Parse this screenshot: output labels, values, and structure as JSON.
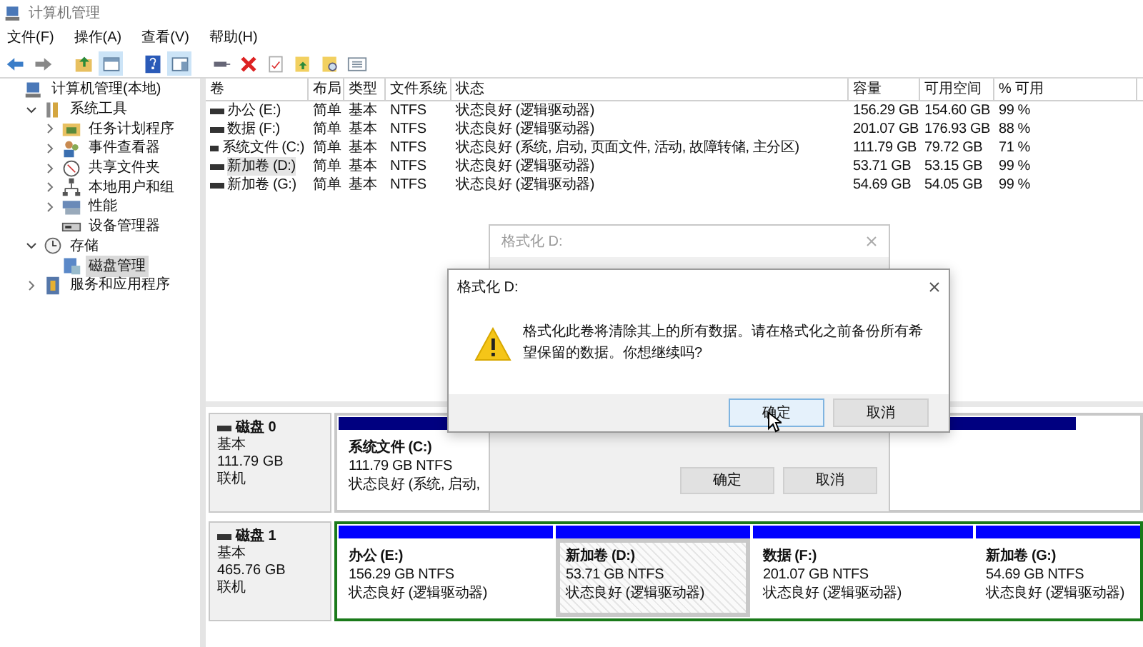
{
  "window": {
    "title": "计算机管理"
  },
  "menu": [
    "文件(F)",
    "操作(A)",
    "查看(V)",
    "帮助(H)"
  ],
  "tree": [
    {
      "label": "计算机管理(本地)",
      "selected": false,
      "children": [
        {
          "label": "系统工具",
          "expanded": true,
          "selected": false,
          "children": [
            {
              "label": "任务计划程序",
              "expanded": false,
              "selected": false
            },
            {
              "label": "事件查看器",
              "expanded": false,
              "selected": false
            },
            {
              "label": "共享文件夹",
              "expanded": false,
              "selected": false
            },
            {
              "label": "本地用户和组",
              "expanded": false,
              "selected": false
            },
            {
              "label": "性能",
              "expanded": false,
              "selected": false
            },
            {
              "label": "设备管理器",
              "selected": false
            }
          ]
        },
        {
          "label": "存储",
          "expanded": true,
          "selected": false,
          "children": [
            {
              "label": "磁盘管理",
              "selected": true
            }
          ]
        },
        {
          "label": "服务和应用程序",
          "expanded": false,
          "selected": false
        }
      ]
    }
  ],
  "table": {
    "columns": [
      "卷",
      "布局",
      "类型",
      "文件系统",
      "状态",
      "容量",
      "可用空间",
      "% 可用"
    ],
    "rows": [
      {
        "cells": [
          "办公 (E:)",
          "简单",
          "基本",
          "NTFS",
          "状态良好 (逻辑驱动器)",
          "156.29 GB",
          "154.60 GB",
          "99 %"
        ],
        "selected": false
      },
      {
        "cells": [
          "数据 (F:)",
          "简单",
          "基本",
          "NTFS",
          "状态良好 (逻辑驱动器)",
          "201.07 GB",
          "176.93 GB",
          "88 %"
        ],
        "selected": false
      },
      {
        "cells": [
          "系统文件 (C:)",
          "简单",
          "基本",
          "NTFS",
          "状态良好 (系统, 启动, 页面文件, 活动, 故障转储, 主分区)",
          "111.79 GB",
          "79.72 GB",
          "71 %"
        ],
        "selected": false
      },
      {
        "cells": [
          "新加卷 (D:)",
          "简单",
          "基本",
          "NTFS",
          "状态良好 (逻辑驱动器)",
          "53.71 GB",
          "53.15 GB",
          "99 %"
        ],
        "selected": true
      },
      {
        "cells": [
          "新加卷 (G:)",
          "简单",
          "基本",
          "NTFS",
          "状态良好 (逻辑驱动器)",
          "54.69 GB",
          "54.05 GB",
          "99 %"
        ],
        "selected": false
      }
    ]
  },
  "disks": [
    {
      "name": "磁盘 0",
      "type": "基本",
      "size": "111.79 GB",
      "status": "联机",
      "extended": false,
      "partitions": [
        {
          "name": "系统文件 (C:)",
          "size": "111.79 GB NTFS",
          "status": "状态良好 (系统, 启动,",
          "kind": "primary",
          "selected": false
        }
      ]
    },
    {
      "name": "磁盘 1",
      "type": "基本",
      "size": "465.76 GB",
      "status": "联机",
      "extended": true,
      "partitions": [
        {
          "name": "办公 (E:)",
          "size": "156.29 GB NTFS",
          "status": "状态良好 (逻辑驱动器)",
          "kind": "logical",
          "selected": false
        },
        {
          "name": "新加卷 (D:)",
          "size": "53.71 GB NTFS",
          "status": "状态良好 (逻辑驱动器)",
          "kind": "logical",
          "selected": true
        },
        {
          "name": "数据 (F:)",
          "size": "201.07 GB NTFS",
          "status": "状态良好 (逻辑驱动器)",
          "kind": "logical",
          "selected": false
        },
        {
          "name": "新加卷 (G:)",
          "size": "54.69 GB NTFS",
          "status": "状态良好 (逻辑驱动器)",
          "kind": "logical",
          "selected": false
        }
      ]
    }
  ],
  "back_dialog": {
    "title": "格式化 D:",
    "buttons": [
      "确定",
      "取消"
    ]
  },
  "dialog": {
    "title": "格式化 D:",
    "message": "格式化此卷将清除其上的所有数据。请在格式化之前备份所有希望保留的数据。你想继续吗?",
    "buttons": [
      {
        "label": "确定",
        "hovered": true
      },
      {
        "label": "取消",
        "hovered": false
      }
    ]
  }
}
